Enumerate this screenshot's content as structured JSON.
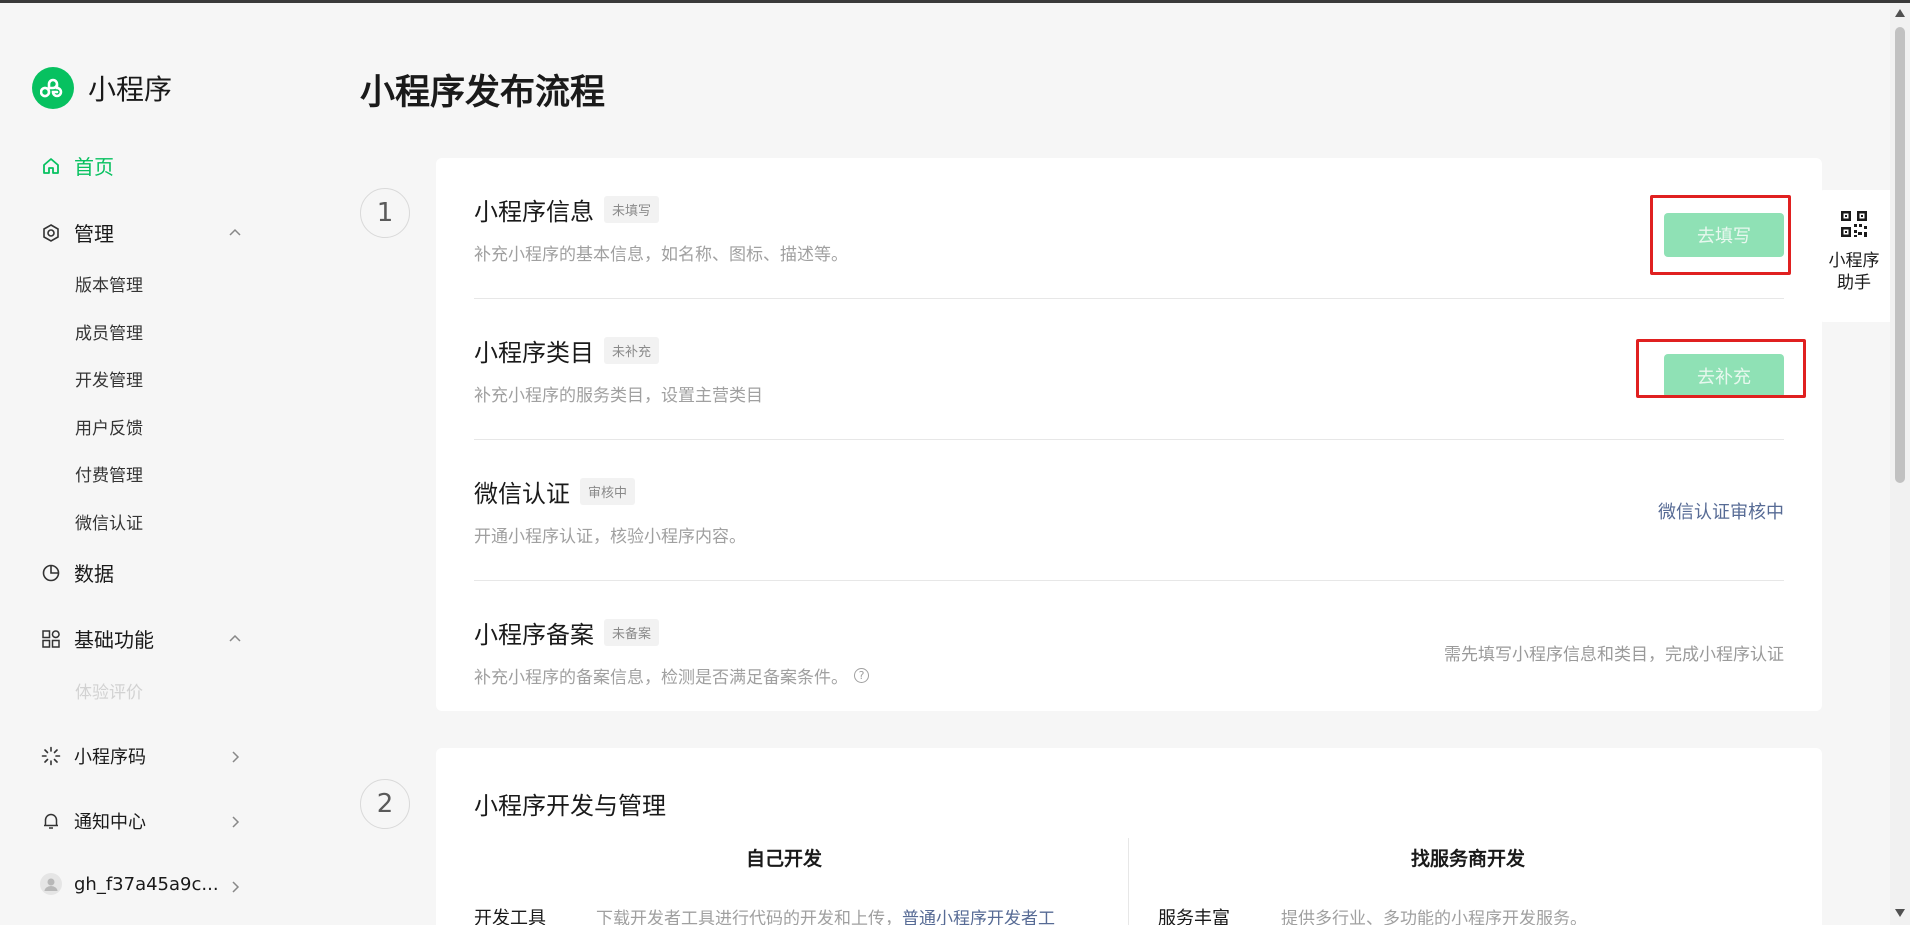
{
  "brand": {
    "name": "小程序"
  },
  "page_title": "小程序发布流程",
  "sidebar": {
    "home": "首页",
    "manage": "管理",
    "manage_items": [
      "版本管理",
      "成员管理",
      "开发管理",
      "用户反馈",
      "付费管理",
      "微信认证"
    ],
    "data": "数据",
    "basic": "基础功能",
    "basic_items": [
      "体验评价"
    ],
    "qrcode": "小程序码",
    "notify": "通知中心",
    "account": "gh_f37a45a9c..."
  },
  "steps": [
    "1",
    "2"
  ],
  "rows": [
    {
      "title": "小程序信息",
      "badge": "未填写",
      "desc": "补充小程序的基本信息，如名称、图标、描述等。",
      "action": "去填写"
    },
    {
      "title": "小程序类目",
      "badge": "未补充",
      "desc": "补充小程序的服务类目，设置主营类目",
      "action": "去补充"
    },
    {
      "title": "微信认证",
      "badge": "审核中",
      "desc": "开通小程序认证，核验小程序内容。",
      "status": "微信认证审核中"
    },
    {
      "title": "小程序备案",
      "badge": "未备案",
      "desc": "补充小程序的备案信息，检测是否满足备案条件。",
      "status": "需先填写小程序信息和类目，完成小程序认证",
      "help": "?"
    }
  ],
  "dev": {
    "title": "小程序开发与管理",
    "self_title": "自己开发",
    "vendor_title": "找服务商开发",
    "self_label": "开发工具",
    "self_desc": "下载开发者工具进行代码的开发和上传，",
    "self_link": "普通小程序开发者工",
    "vendor_label": "服务丰富",
    "vendor_desc": "提供多行业、多功能的小程序开发服务。"
  },
  "helper": {
    "label": "小程序助手"
  },
  "colors": {
    "accent": "#07c160",
    "link": "#576b95",
    "highlight": "#e02020"
  }
}
